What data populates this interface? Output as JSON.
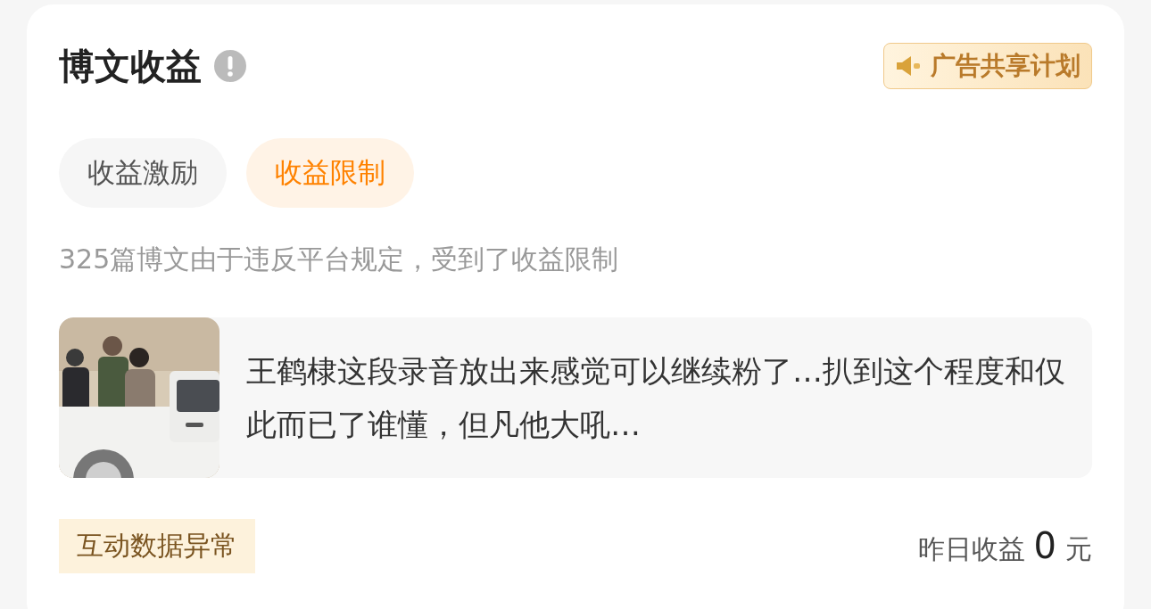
{
  "header": {
    "title": "博文收益",
    "ad_badge": "广告共享计划"
  },
  "tabs": [
    {
      "label": "收益激励",
      "selected": false
    },
    {
      "label": "收益限制",
      "selected": true
    }
  ],
  "description": "325篇博文由于违反平台规定，受到了收益限制",
  "post": {
    "text": "王鹤棣这段录音放出来感觉可以继续粉了…扒到这个程度和仅此而已了谁懂，但凡他大吼…"
  },
  "footer": {
    "tag": "互动数据异常",
    "earnings_label": "昨日收益",
    "earnings_value": "0",
    "earnings_unit": "元"
  }
}
